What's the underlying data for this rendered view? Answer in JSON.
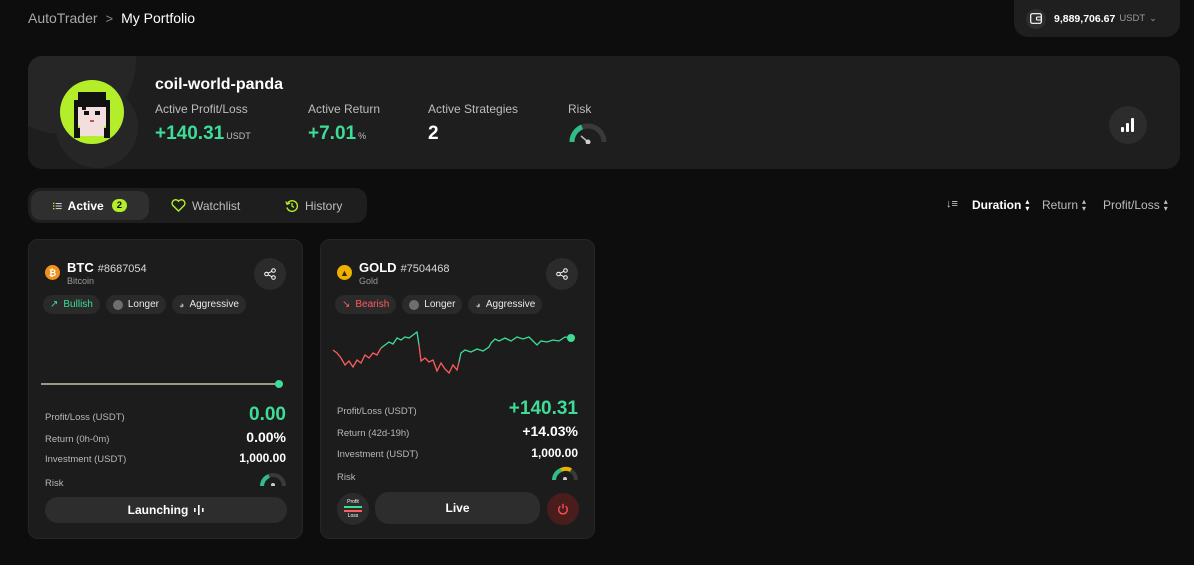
{
  "breadcrumb": {
    "root": "AutoTrader",
    "separator": ">",
    "current": "My Portfolio"
  },
  "wallet": {
    "balance": "9,889,706.67",
    "unit": "USDT",
    "icon": "wallet-icon"
  },
  "profile": {
    "username": "coil-world-panda",
    "stats": {
      "profit_loss": {
        "label": "Active Profit/Loss",
        "value": "+140.31",
        "unit": "USDT"
      },
      "return": {
        "label": "Active Return",
        "value": "+7.01",
        "unit": "%"
      },
      "strategies": {
        "label": "Active Strategies",
        "value": "2"
      },
      "risk": {
        "label": "Risk",
        "level": 0.35
      }
    }
  },
  "tabs": [
    {
      "label": "Active",
      "badge": "2",
      "icon": "list-icon"
    },
    {
      "label": "Watchlist",
      "icon": "heart-icon"
    },
    {
      "label": "History",
      "icon": "history-icon"
    }
  ],
  "sort": {
    "duration": "Duration",
    "return": "Return",
    "profit_loss": "Profit/Loss"
  },
  "colors": {
    "accent": "#b4ee2a",
    "positive": "#3ddc97",
    "negative": "#ff5c5c"
  },
  "cards": [
    {
      "symbol": "BTC",
      "id": "#8687054",
      "name": "Bitcoin",
      "chips": [
        "Bullish",
        "Longer",
        "Aggressive"
      ],
      "rows": [
        {
          "k": "Profit/Loss (USDT)",
          "v": "0.00"
        },
        {
          "k": "Return (0h-0m)",
          "v": "0.00%"
        },
        {
          "k": "Investment (USDT)",
          "v": "1,000.00"
        },
        {
          "k": "Risk"
        }
      ],
      "risk_level": 0.25,
      "action": "Launching"
    },
    {
      "symbol": "GOLD",
      "id": "#7504468",
      "name": "Gold",
      "chips": [
        "Bearish",
        "Longer",
        "Aggressive"
      ],
      "rows": [
        {
          "k": "Profit/Loss (USDT)",
          "v": "+140.31"
        },
        {
          "k": "Return (42d-19h)",
          "v": "+14.03%"
        },
        {
          "k": "Investment (USDT)",
          "v": "1,000.00"
        },
        {
          "k": "Risk"
        }
      ],
      "risk_level": 0.65,
      "pl_button": [
        "Profit",
        "Loss"
      ],
      "action": "Live"
    }
  ]
}
